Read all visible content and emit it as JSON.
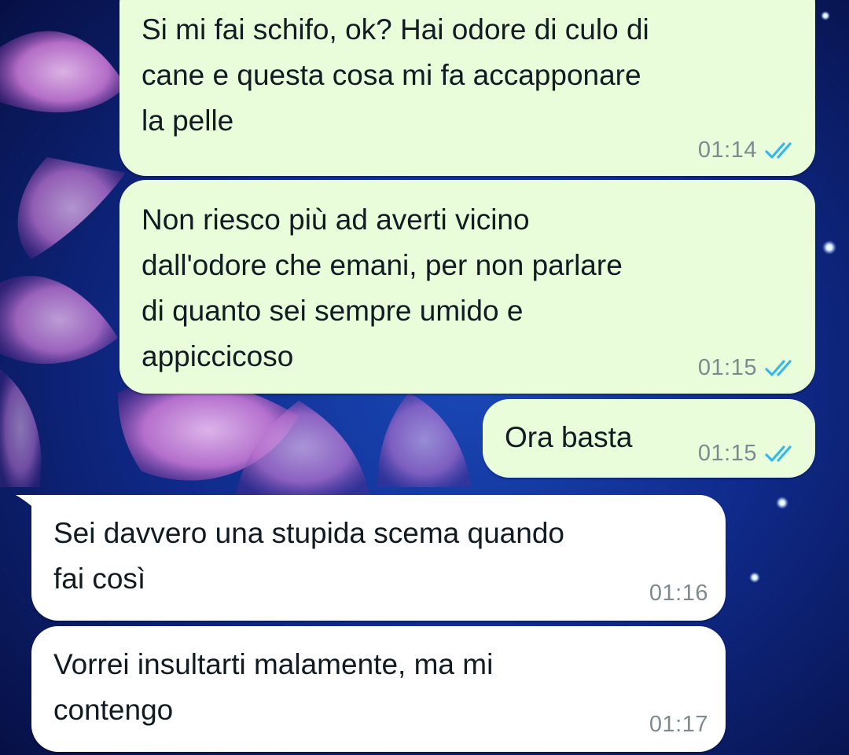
{
  "chat": {
    "messages": [
      {
        "direction": "outgoing",
        "text": "Si mi fai schifo, ok? Hai odore di culo di\ncane e questa cosa mi fa accapponare\nla pelle",
        "time": "01:14",
        "status_icon": "double-check-read-icon"
      },
      {
        "direction": "outgoing",
        "text": "Non riesco più ad averti vicino\ndall'odore che emani, per non parlare\ndi quanto sei sempre umido e\nappiccicoso",
        "time": "01:15",
        "status_icon": "double-check-read-icon"
      },
      {
        "direction": "outgoing",
        "text": "Ora basta",
        "time": "01:15",
        "status_icon": "double-check-read-icon"
      },
      {
        "direction": "incoming",
        "text": "Sei davvero una stupida scema quando\nfai così",
        "time": "01:16"
      },
      {
        "direction": "incoming",
        "text": "Vorrei insultarti malamente, ma mi\ncontengo",
        "time": "01:17"
      }
    ]
  },
  "colors": {
    "outgoing_bubble": "#e9fddb",
    "incoming_bubble": "#ffffff",
    "read_check": "#34b7f1",
    "time_text": "#7f8a8f",
    "wallpaper_base": "#0a1450",
    "flower_accent": "#e0a0e8"
  }
}
